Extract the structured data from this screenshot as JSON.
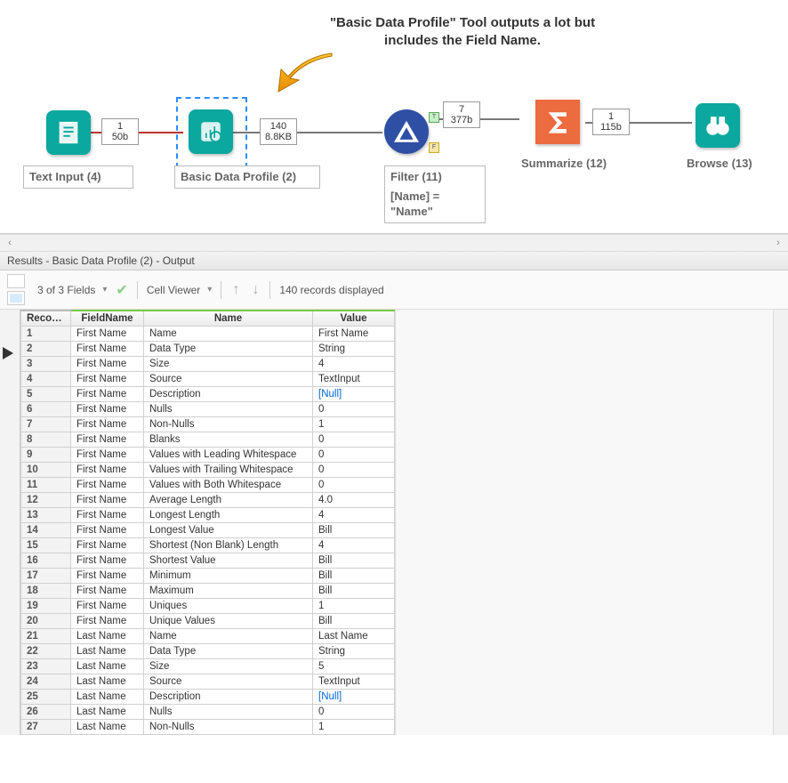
{
  "canvas": {
    "callout": "\"Basic Data Profile\" Tool outputs a lot but includes the Field Name.",
    "tools": {
      "text_input": {
        "label": "Text Input (4)",
        "badge_top": "1",
        "badge_bot": "50b"
      },
      "basic_profile": {
        "label": "Basic Data Profile (2)",
        "badge_top": "140",
        "badge_bot": "8.8KB"
      },
      "filter": {
        "label": "Filter (11)",
        "sub1": "[Name] =",
        "sub2": "\"Name\"",
        "badge_top": "7",
        "badge_bot": "377b"
      },
      "summarize": {
        "label": "Summarize (12)",
        "badge_top": "1",
        "badge_bot": "115b"
      },
      "browse": {
        "label": "Browse (13)"
      }
    }
  },
  "results_title": "Results - Basic Data Profile (2) - Output",
  "toolbar": {
    "fields": "3 of 3 Fields",
    "cellview": "Cell Viewer",
    "records": "140 records displayed"
  },
  "grid": {
    "columns": [
      "Record #",
      "FieldName",
      "Name",
      "Value"
    ],
    "rows": [
      {
        "n": "1",
        "field": "First Name",
        "name": "Name",
        "value": "First Name"
      },
      {
        "n": "2",
        "field": "First Name",
        "name": "Data Type",
        "value": "String"
      },
      {
        "n": "3",
        "field": "First Name",
        "name": "Size",
        "value": "4"
      },
      {
        "n": "4",
        "field": "First Name",
        "name": "Source",
        "value": "TextInput"
      },
      {
        "n": "5",
        "field": "First Name",
        "name": "Description",
        "value": "[Null]",
        "null": true
      },
      {
        "n": "6",
        "field": "First Name",
        "name": "Nulls",
        "value": "0"
      },
      {
        "n": "7",
        "field": "First Name",
        "name": "Non-Nulls",
        "value": "1"
      },
      {
        "n": "8",
        "field": "First Name",
        "name": "Blanks",
        "value": "0"
      },
      {
        "n": "9",
        "field": "First Name",
        "name": "Values with Leading Whitespace",
        "value": "0"
      },
      {
        "n": "10",
        "field": "First Name",
        "name": "Values with Trailing Whitespace",
        "value": "0"
      },
      {
        "n": "11",
        "field": "First Name",
        "name": "Values with Both Whitespace",
        "value": "0"
      },
      {
        "n": "12",
        "field": "First Name",
        "name": "Average Length",
        "value": "4.0"
      },
      {
        "n": "13",
        "field": "First Name",
        "name": "Longest Length",
        "value": "4"
      },
      {
        "n": "14",
        "field": "First Name",
        "name": "Longest Value",
        "value": "Bill"
      },
      {
        "n": "15",
        "field": "First Name",
        "name": "Shortest (Non Blank) Length",
        "value": "4"
      },
      {
        "n": "16",
        "field": "First Name",
        "name": "Shortest Value",
        "value": "Bill"
      },
      {
        "n": "17",
        "field": "First Name",
        "name": "Minimum",
        "value": "Bill"
      },
      {
        "n": "18",
        "field": "First Name",
        "name": "Maximum",
        "value": "Bill"
      },
      {
        "n": "19",
        "field": "First Name",
        "name": "Uniques",
        "value": "1"
      },
      {
        "n": "20",
        "field": "First Name",
        "name": "Unique Values",
        "value": "Bill"
      },
      {
        "n": "21",
        "field": "Last Name",
        "name": "Name",
        "value": "Last Name"
      },
      {
        "n": "22",
        "field": "Last Name",
        "name": "Data Type",
        "value": "String"
      },
      {
        "n": "23",
        "field": "Last Name",
        "name": "Size",
        "value": "5"
      },
      {
        "n": "24",
        "field": "Last Name",
        "name": "Source",
        "value": "TextInput"
      },
      {
        "n": "25",
        "field": "Last Name",
        "name": "Description",
        "value": "[Null]",
        "null": true
      },
      {
        "n": "26",
        "field": "Last Name",
        "name": "Nulls",
        "value": "0"
      },
      {
        "n": "27",
        "field": "Last Name",
        "name": "Non-Nulls",
        "value": "1"
      }
    ]
  }
}
